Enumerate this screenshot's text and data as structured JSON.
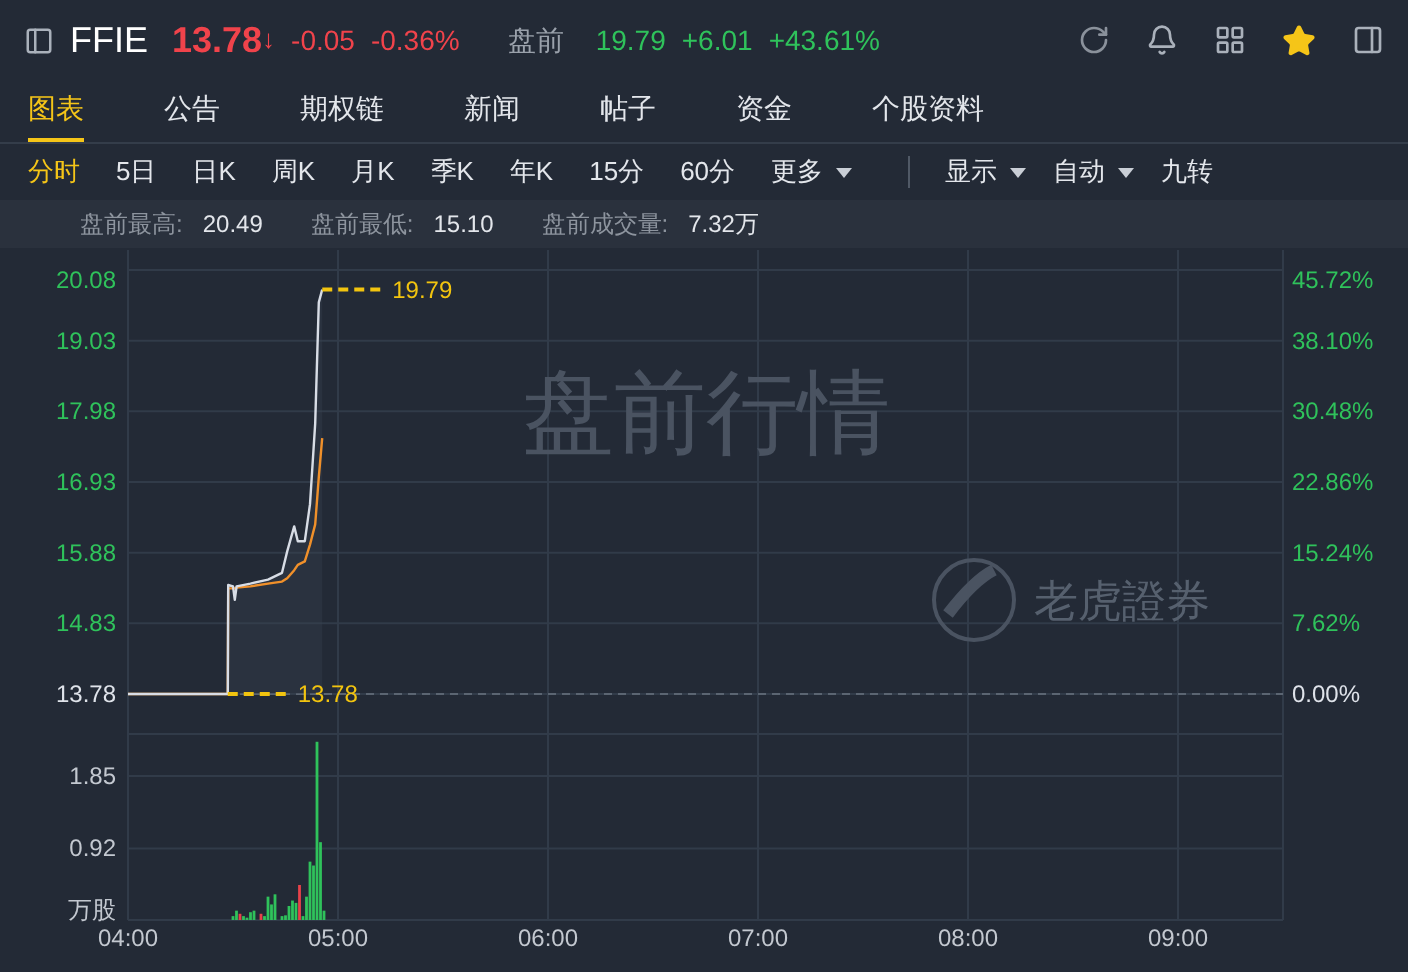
{
  "header": {
    "symbol": "FFIE",
    "price": "13.78",
    "price_arrow": "↓",
    "change": "-0.05",
    "change_pct": "-0.36%",
    "session_label": "盘前",
    "session_price": "19.79",
    "session_change": "+6.01",
    "session_change_pct": "+43.61%",
    "favorited": true
  },
  "tabs": [
    {
      "label": "图表",
      "selected": true
    },
    {
      "label": "公告",
      "selected": false
    },
    {
      "label": "期权链",
      "selected": false
    },
    {
      "label": "新闻",
      "selected": false
    },
    {
      "label": "帖子",
      "selected": false
    },
    {
      "label": "资金",
      "selected": false
    },
    {
      "label": "个股资料",
      "selected": false
    }
  ],
  "periods": [
    {
      "label": "分时",
      "selected": true,
      "dropdown": false
    },
    {
      "label": "5日",
      "selected": false,
      "dropdown": false
    },
    {
      "label": "日K",
      "selected": false,
      "dropdown": false
    },
    {
      "label": "周K",
      "selected": false,
      "dropdown": false
    },
    {
      "label": "月K",
      "selected": false,
      "dropdown": false
    },
    {
      "label": "季K",
      "selected": false,
      "dropdown": false
    },
    {
      "label": "年K",
      "selected": false,
      "dropdown": false
    },
    {
      "label": "15分",
      "selected": false,
      "dropdown": false
    },
    {
      "label": "60分",
      "selected": false,
      "dropdown": false
    },
    {
      "label": "更多",
      "selected": false,
      "dropdown": true
    }
  ],
  "options": [
    {
      "label": "显示",
      "dropdown": true
    },
    {
      "label": "自动",
      "dropdown": true
    },
    {
      "label": "九转",
      "dropdown": false
    }
  ],
  "stats": [
    {
      "label": "盘前最高:",
      "value": "20.49"
    },
    {
      "label": "盘前最低:",
      "value": "15.10"
    },
    {
      "label": "盘前成交量:",
      "value": "7.32万"
    }
  ],
  "watermark": {
    "title": "盘前行情",
    "brand": "老虎證券"
  },
  "price_chart": {
    "right_axis_labels": [
      "45.72%",
      "38.10%",
      "30.48%",
      "22.86%",
      "15.24%",
      "7.62%",
      "0.00%"
    ],
    "chart_data": {
      "type": "line",
      "grid": true,
      "xlim": [
        4,
        9.5
      ],
      "ylim": [
        13.78,
        20.08
      ],
      "yticks": [
        {
          "value": 20.08,
          "label": "20.08"
        },
        {
          "value": 19.03,
          "label": "19.03"
        },
        {
          "value": 17.98,
          "label": "17.98"
        },
        {
          "value": 16.93,
          "label": "16.93"
        },
        {
          "value": 15.88,
          "label": "15.88"
        },
        {
          "value": 14.83,
          "label": "14.83"
        },
        {
          "value": 13.78,
          "label": "13.78"
        }
      ],
      "x": [
        4,
        4.475,
        4.4767,
        4.5,
        4.5083,
        4.5167,
        4.5833,
        4.6667,
        4.7333,
        4.7583,
        4.7917,
        4.8083,
        4.8417,
        4.8667,
        4.8917,
        4.9083,
        4.925
      ],
      "series": [
        {
          "color": "#d8dde6",
          "values": [
            13.78,
            13.78,
            15.4,
            15.38,
            15.18,
            15.38,
            15.42,
            15.48,
            15.58,
            15.9,
            16.27,
            16.05,
            16.05,
            16.6,
            17.8,
            19.6,
            19.79
          ]
        },
        {
          "color": "#f0902a",
          "values": [
            13.78,
            13.78,
            15.35,
            15.35,
            15.35,
            15.36,
            15.38,
            15.42,
            15.45,
            15.5,
            15.62,
            15.7,
            15.75,
            16.0,
            16.3,
            17.0,
            17.58
          ]
        }
      ],
      "annotations": [
        {
          "x": 4.925,
          "y": 19.79,
          "text": "19.79"
        },
        {
          "x": 4.475,
          "y": 13.78,
          "text": "13.78"
        }
      ]
    }
  },
  "volume_chart": {
    "chart_data": {
      "type": "bar",
      "grid": true,
      "ylabel": "万股",
      "xlim": [
        4,
        9.5
      ],
      "ylim": [
        0,
        2.39
      ],
      "yticks": [
        {
          "value": 1.85,
          "label": "1.85"
        },
        {
          "value": 0.92,
          "label": "0.92"
        }
      ],
      "xticks": [
        {
          "value": 4,
          "label": "04:00"
        },
        {
          "value": 5,
          "label": "05:00"
        },
        {
          "value": 6,
          "label": "06:00"
        },
        {
          "value": 7,
          "label": "07:00"
        },
        {
          "value": 8,
          "label": "08:00"
        },
        {
          "value": 9,
          "label": "09:00"
        }
      ],
      "x": [
        4.5,
        4.5167,
        4.5333,
        4.55,
        4.5667,
        4.5833,
        4.6,
        4.6167,
        4.6333,
        4.65,
        4.6667,
        4.6833,
        4.7,
        4.7167,
        4.7333,
        4.75,
        4.7667,
        4.7833,
        4.8,
        4.8167,
        4.8333,
        4.85,
        4.8667,
        4.8833,
        4.9,
        4.9167,
        4.9333
      ],
      "stacked": true,
      "series": [
        {
          "color": "#2fc25b",
          "values": [
            0.05,
            0.12,
            null,
            0.05,
            0.03,
            0.1,
            0.12,
            null,
            null,
            0.05,
            0.3,
            0.2,
            0.33,
            null,
            0.05,
            0.06,
            0.18,
            0.25,
            0.22,
            null,
            0.05,
            0.3,
            0.75,
            0.7,
            2.29,
            1.0,
            0.12
          ]
        },
        {
          "color": "#e8424a",
          "values": [
            null,
            null,
            0.08,
            null,
            null,
            null,
            null,
            null,
            0.08,
            null,
            null,
            null,
            null,
            null,
            null,
            null,
            null,
            null,
            null,
            0.45,
            null,
            null,
            null,
            null,
            null,
            null,
            null
          ]
        }
      ]
    }
  }
}
